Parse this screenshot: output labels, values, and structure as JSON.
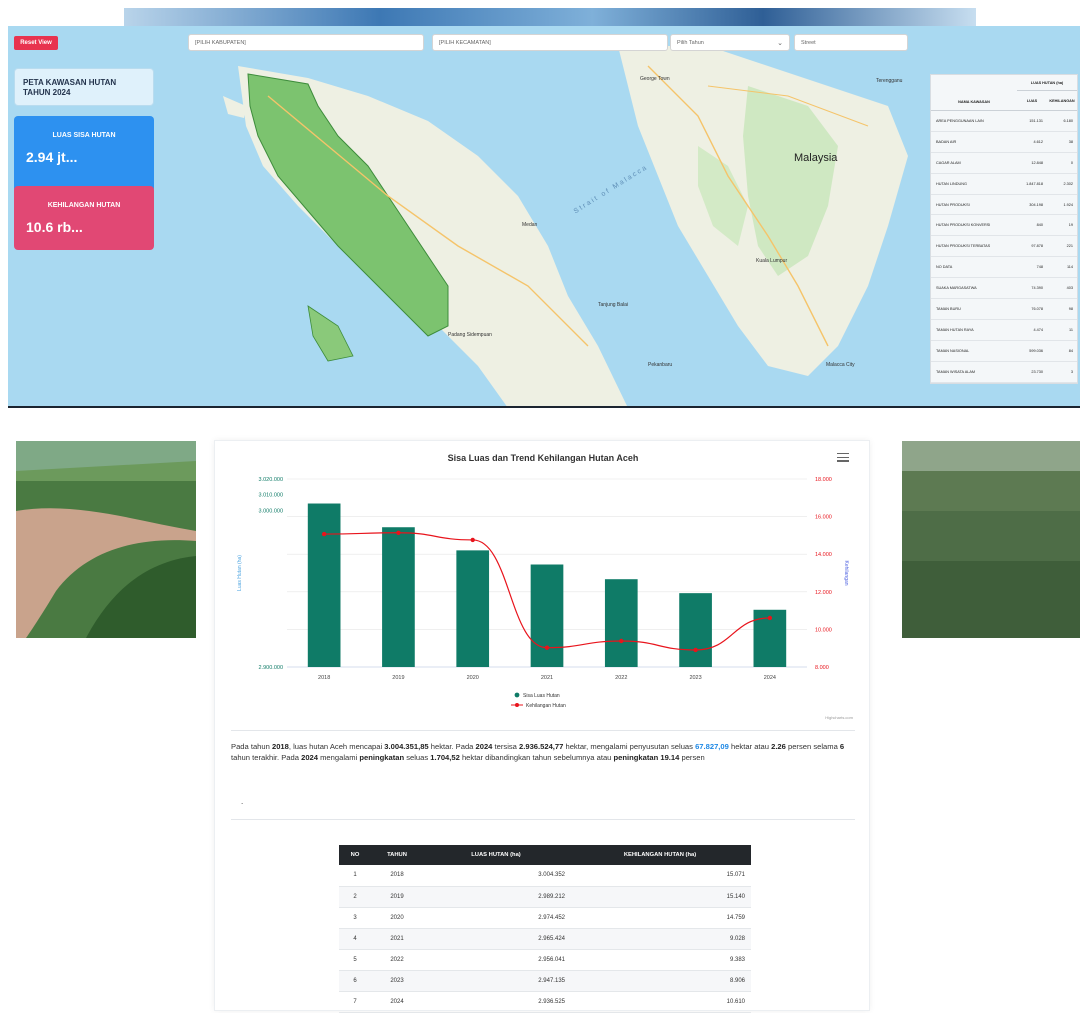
{
  "map": {
    "reset_label": "Reset View",
    "kabupaten_placeholder": "[PILIH KABUPATEN]",
    "kecamatan_placeholder": "[PILIH KECAMATAN]",
    "tahun_placeholder": "Pilih Tahun",
    "basemap_value": "Street",
    "title_card": "PETA KAWASAN HUTAN TAHUN 2024",
    "luas_label": "LUAS SISA HUTAN",
    "luas_value": "2.94 jt...",
    "kehilangan_label": "KEHILANGAN HUTAN",
    "kehilangan_value": "10.6 rb...",
    "labels": {
      "malaysia": "Malaysia",
      "strait": "Strait of Malacca",
      "medan": "Medan",
      "kuala_lumpur": "Kuala Lumpur",
      "george_town": "George Town",
      "terengganu": "Terengganu",
      "padang": "Padang Sidempuan",
      "tanjung_balai": "Tanjung Balai",
      "pekanbaru": "Pekanbaru",
      "malacca": "Malacca City"
    },
    "legend": {
      "name_header": "NAMA KAWASAN",
      "group_header": "LUAS HUTAN (ha)",
      "luas_header": "LUAS",
      "kehilangan_header": "KEHILANGAN",
      "rows": [
        {
          "name": "AREA PENGGUNAAN LAIN",
          "luas": "151.131",
          "kehil": "6.180"
        },
        {
          "name": "BADAN AIR",
          "luas": "4.612",
          "kehil": "38"
        },
        {
          "name": "CAGAR ALAM",
          "luas": "12.848",
          "kehil": "0"
        },
        {
          "name": "HUTAN LINDUNG",
          "luas": "1.847.818",
          "kehil": "2.302"
        },
        {
          "name": "HUTAN PRODUKSI",
          "luas": "304.198",
          "kehil": "1.924"
        },
        {
          "name": "HUTAN PRODUKSI KONVERSI",
          "luas": "840",
          "kehil": "19"
        },
        {
          "name": "HUTAN PRODUKSI TERBATAS",
          "luas": "97.878",
          "kehil": "221"
        },
        {
          "name": "NO DATA",
          "luas": "748",
          "kehil": "114"
        },
        {
          "name": "SUAKA MARGASATWA",
          "luas": "74.390",
          "kehil": "403"
        },
        {
          "name": "TAMAN BURU",
          "luas": "76.078",
          "kehil": "98"
        },
        {
          "name": "TAMAN HUTAN RAYA",
          "luas": "4.474",
          "kehil": "11"
        },
        {
          "name": "TAMAN NASIONAL",
          "luas": "599.036",
          "kehil": "84"
        },
        {
          "name": "TAMAN WISATA ALAM",
          "luas": "23.730",
          "kehil": "3"
        }
      ]
    }
  },
  "chart_data": {
    "type": "bar",
    "title": "Sisa Luas dan Trend Kehilangan Hutan Aceh",
    "xlabel": "",
    "ylabel": "Luas Hutan (ha)",
    "y2label": "Kehilangan",
    "categories": [
      "2018",
      "2019",
      "2020",
      "2021",
      "2022",
      "2023",
      "2024"
    ],
    "left_ticks": [
      "2.900.000",
      "3.000.000",
      "3.010.000",
      "3.020.000"
    ],
    "right_ticks": [
      "8.000",
      "10.000",
      "12.000",
      "14.000",
      "16.000",
      "18.000"
    ],
    "y2lim": [
      8000,
      18000
    ],
    "series": [
      {
        "name": "Sisa Luas Hutan",
        "kind": "bar",
        "color": "#0f7b67",
        "values": [
          3004352,
          2989212,
          2974452,
          2965424,
          2956041,
          2947135,
          2936525
        ]
      },
      {
        "name": "Kehilangan Hutan",
        "kind": "line",
        "axis": "right",
        "color": "#e8141c",
        "values": [
          15071,
          15140,
          14759,
          9028,
          9383,
          8906,
          10610
        ]
      }
    ],
    "legend_position": "bottom",
    "credit": "Highcharts.com"
  },
  "summary": {
    "p1": "Pada tahun ",
    "y1": "2018",
    "p2": ", luas hutan Aceh mencapai ",
    "v1": "3.004.351,85",
    "p3": " hektar. Pada ",
    "y2": "2024",
    "p4": " tersisa ",
    "v2": "2.936.524,77",
    "p5": " hektar, mengalami penyusutan seluas ",
    "v3": "67.827,09",
    "p6": " hektar atau ",
    "v4": "2.26",
    "p7": " persen selama ",
    "v5": "6",
    "p8": " tahun terakhir. Pada ",
    "y3": "2024",
    "p9": " mengalami ",
    "v6": "peningkatan",
    "p10": " seluas ",
    "v7": "1.704,52",
    "p11": " hektar dibandingkan tahun sebelumnya atau ",
    "v8": "peningkatan 19.14",
    "p12": " persen",
    "dot": "."
  },
  "table": {
    "headers": [
      "NO",
      "TAHUN",
      "LUAS HUTAN (ha)",
      "KEHILANGAN HUTAN (ha)"
    ],
    "rows": [
      [
        "1",
        "2018",
        "3.004.352",
        "15.071"
      ],
      [
        "2",
        "2019",
        "2.989.212",
        "15.140"
      ],
      [
        "3",
        "2020",
        "2.974.452",
        "14.759"
      ],
      [
        "4",
        "2021",
        "2.965.424",
        "9.028"
      ],
      [
        "5",
        "2022",
        "2.956.041",
        "9.383"
      ],
      [
        "6",
        "2023",
        "2.947.135",
        "8.906"
      ],
      [
        "7",
        "2024",
        "2.936.525",
        "10.610"
      ]
    ]
  }
}
